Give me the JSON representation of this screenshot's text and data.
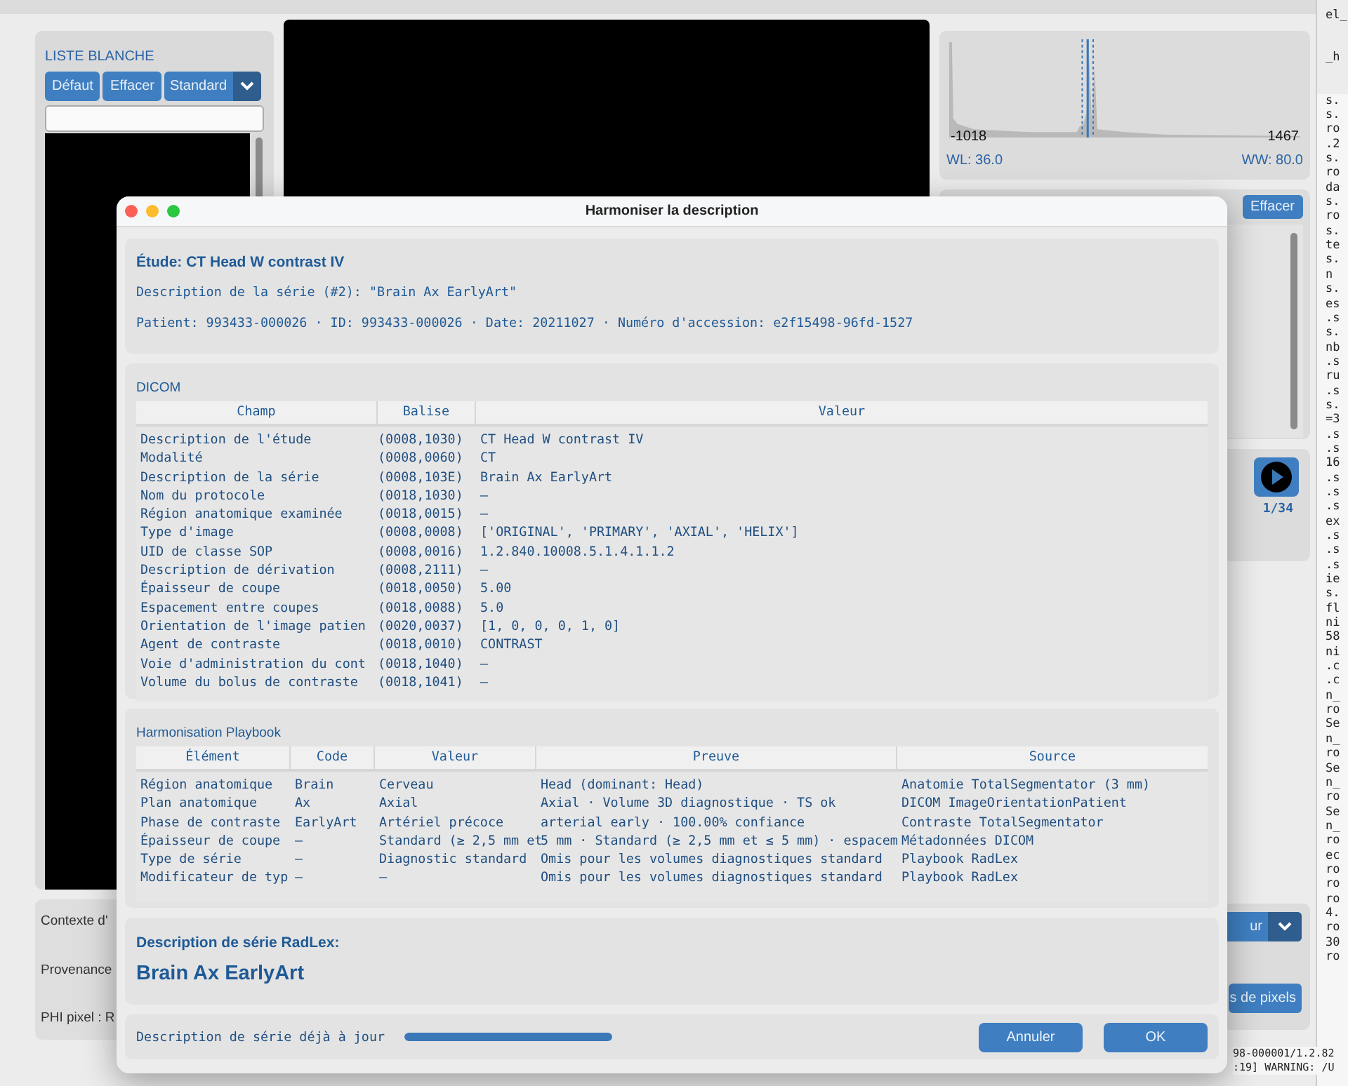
{
  "background": {
    "whitelist": {
      "title": "LISTE BLANCHE",
      "buttons": [
        "Défaut",
        "Effacer"
      ],
      "preset": "Standard"
    },
    "histogram": {
      "min": "-1018",
      "max": "1467",
      "wl": "WL: 36.0",
      "ww": "WW: 80.0"
    },
    "clear_button": "Effacer",
    "frame_counter": "1/34",
    "info_labels": [
      "Contexte d'",
      "Provenance",
      "PHI pixel : R"
    ],
    "dropdown_value": "ur",
    "pixel_button": "s de pixels",
    "log_top": [
      "el_",
      "_h"
    ],
    "log_lines": [
      "s.",
      "s.",
      "ro",
      ".2",
      "s.",
      "ro",
      "da",
      "s.",
      "ro",
      "s.",
      "te",
      "s.",
      "n",
      "s.",
      "es",
      ".s",
      "s.",
      "nb",
      ".s",
      "ru",
      ".s",
      "s.",
      "=3",
      ".s",
      ".s",
      "16",
      ".s",
      ".s",
      ".s",
      "ex",
      ".s",
      ".s",
      ".s",
      "ie",
      "s.",
      "fl",
      "ni",
      "58",
      "ni",
      ".c",
      ".c",
      "n_",
      "ro",
      "Se",
      "n_",
      "ro",
      "Se",
      "n_",
      "ro",
      "Se",
      "n_",
      "ro",
      "ec",
      "ro",
      "ro",
      "ro",
      "4.",
      "ro",
      "30",
      "ro"
    ],
    "log_bottom": [
      "98-000001/1.2.82",
      ":19] WARNING: /U"
    ]
  },
  "dialog": {
    "title": "Harmoniser la description",
    "study": {
      "heading": "Étude: CT Head W contrast IV",
      "series_line": "Description de la série (#2): \"Brain Ax EarlyArt\"",
      "patient_line": "Patient: 993433-000026 · ID: 993433-000026 · Date: 20211027 · Numéro d'accession: e2f15498-96fd-1527"
    },
    "dicom": {
      "title": "DICOM",
      "columns": [
        "Champ",
        "Balise",
        "Valeur"
      ],
      "rows": [
        [
          "Description de l'étude",
          "(0008,1030)",
          "CT Head W contrast IV"
        ],
        [
          "Modalité",
          "(0008,0060)",
          "CT"
        ],
        [
          "Description de la série",
          "(0008,103E)",
          "Brain Ax EarlyArt"
        ],
        [
          "Nom du protocole",
          "(0018,1030)",
          "—"
        ],
        [
          "Région anatomique examinée",
          "(0018,0015)",
          "—"
        ],
        [
          "Type d'image",
          "(0008,0008)",
          "['ORIGINAL', 'PRIMARY', 'AXIAL', 'HELIX']"
        ],
        [
          "UID de classe SOP",
          "(0008,0016)",
          "1.2.840.10008.5.1.4.1.1.2"
        ],
        [
          "Description de dérivation",
          "(0008,2111)",
          "—"
        ],
        [
          "Épaisseur de coupe",
          "(0018,0050)",
          "5.00"
        ],
        [
          "Espacement entre coupes",
          "(0018,0088)",
          "5.0"
        ],
        [
          "Orientation de l'image patien",
          "(0020,0037)",
          "[1, 0, 0, 0, 1, 0]"
        ],
        [
          "Agent de contraste",
          "(0018,0010)",
          "CONTRAST"
        ],
        [
          "Voie d'administration du cont",
          "(0018,1040)",
          "—"
        ],
        [
          "Volume du bolus de contraste",
          "(0018,1041)",
          "—"
        ]
      ]
    },
    "playbook": {
      "title": "Harmonisation Playbook",
      "columns": [
        "Élément",
        "Code",
        "Valeur",
        "Preuve",
        "Source"
      ],
      "rows": [
        [
          "Région anatomique",
          "Brain",
          "Cerveau",
          "Head (dominant: Head)",
          "Anatomie TotalSegmentator (3 mm)"
        ],
        [
          "Plan anatomique",
          "Ax",
          "Axial",
          "Axial · Volume 3D diagnostique · TS ok",
          "DICOM ImageOrientationPatient"
        ],
        [
          "Phase de contraste",
          "EarlyArt",
          "Artériel précoce",
          "arterial early · 100.00% confiance",
          "Contraste TotalSegmentator"
        ],
        [
          "Épaisseur de coupe",
          "—",
          "Standard (≥ 2,5 mm et",
          "5 mm · Standard (≥ 2,5 mm et ≤ 5 mm) · espacem",
          "Métadonnées DICOM"
        ],
        [
          "Type de série",
          "—",
          "Diagnostic standard",
          "Omis pour les volumes diagnostiques standard",
          "Playbook RadLex"
        ],
        [
          "Modificateur de typ",
          "—",
          "—",
          "Omis pour les volumes diagnostiques standard",
          "Playbook RadLex"
        ]
      ]
    },
    "radlex": {
      "label": "Description de série RadLex:",
      "value": "Brain Ax EarlyArt"
    },
    "footer": {
      "status": "Description de série déjà à jour",
      "progress": {
        "level": 1
      },
      "buttons": [
        "Annuler",
        "OK"
      ]
    }
  }
}
